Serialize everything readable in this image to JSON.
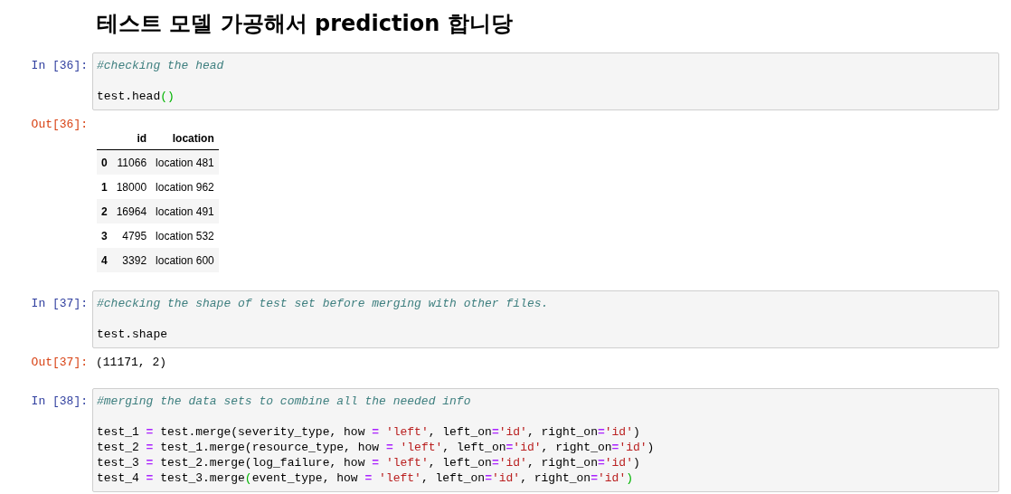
{
  "heading": "테스트 모델 가공해서 prediction 합니당",
  "cells": [
    {
      "kind": "input",
      "prompt": "In [36]:",
      "comment": "#checking the head",
      "lines": [
        [
          {
            "kind": "name",
            "text": "test.head"
          },
          {
            "kind": "match",
            "text": "()"
          }
        ]
      ]
    },
    {
      "kind": "table",
      "prompt": "Out[36]:",
      "columns": [
        "id",
        "location"
      ],
      "rows": [
        {
          "index": "0",
          "cells": [
            "11066",
            "location 481"
          ]
        },
        {
          "index": "1",
          "cells": [
            "18000",
            "location 962"
          ]
        },
        {
          "index": "2",
          "cells": [
            "16964",
            "location 491"
          ]
        },
        {
          "index": "3",
          "cells": [
            "4795",
            "location 532"
          ]
        },
        {
          "index": "4",
          "cells": [
            "3392",
            "location 600"
          ]
        }
      ]
    },
    {
      "kind": "input",
      "prompt": "In [37]:",
      "comment": "#checking the shape of test set before merging with other files.",
      "lines": [
        [
          {
            "kind": "name",
            "text": "test.shape"
          }
        ]
      ]
    },
    {
      "kind": "text",
      "prompt": "Out[37]:",
      "text": "(11171, 2)"
    },
    {
      "kind": "input",
      "prompt": "In [38]:",
      "comment": "#merging the data sets to combine all the needed info",
      "lines": [
        [
          {
            "kind": "name",
            "text": "test_1 "
          },
          {
            "kind": "op",
            "text": "="
          },
          {
            "kind": "name",
            "text": " test.merge(severity_type, how "
          },
          {
            "kind": "op",
            "text": "= "
          },
          {
            "kind": "string",
            "text": "'left'"
          },
          {
            "kind": "name",
            "text": ", left_on"
          },
          {
            "kind": "op",
            "text": "="
          },
          {
            "kind": "string",
            "text": "'id'"
          },
          {
            "kind": "name",
            "text": ", right_on"
          },
          {
            "kind": "op",
            "text": "="
          },
          {
            "kind": "string",
            "text": "'id'"
          },
          {
            "kind": "name",
            "text": ")"
          }
        ],
        [
          {
            "kind": "name",
            "text": "test_2 "
          },
          {
            "kind": "op",
            "text": "="
          },
          {
            "kind": "name",
            "text": " test_1.merge(resource_type, how "
          },
          {
            "kind": "op",
            "text": "= "
          },
          {
            "kind": "string",
            "text": "'left'"
          },
          {
            "kind": "name",
            "text": ", left_on"
          },
          {
            "kind": "op",
            "text": "="
          },
          {
            "kind": "string",
            "text": "'id'"
          },
          {
            "kind": "name",
            "text": ", right_on"
          },
          {
            "kind": "op",
            "text": "="
          },
          {
            "kind": "string",
            "text": "'id'"
          },
          {
            "kind": "name",
            "text": ")"
          }
        ],
        [
          {
            "kind": "name",
            "text": "test_3 "
          },
          {
            "kind": "op",
            "text": "="
          },
          {
            "kind": "name",
            "text": " test_2.merge(log_failure, how "
          },
          {
            "kind": "op",
            "text": "= "
          },
          {
            "kind": "string",
            "text": "'left'"
          },
          {
            "kind": "name",
            "text": ", left_on"
          },
          {
            "kind": "op",
            "text": "="
          },
          {
            "kind": "string",
            "text": "'id'"
          },
          {
            "kind": "name",
            "text": ", right_on"
          },
          {
            "kind": "op",
            "text": "="
          },
          {
            "kind": "string",
            "text": "'id'"
          },
          {
            "kind": "name",
            "text": ")"
          }
        ],
        [
          {
            "kind": "name",
            "text": "test_4 "
          },
          {
            "kind": "op",
            "text": "="
          },
          {
            "kind": "name",
            "text": " test_3.merge"
          },
          {
            "kind": "match",
            "text": "("
          },
          {
            "kind": "name",
            "text": "event_type, how "
          },
          {
            "kind": "op",
            "text": "= "
          },
          {
            "kind": "string",
            "text": "'left'"
          },
          {
            "kind": "name",
            "text": ", left_on"
          },
          {
            "kind": "op",
            "text": "="
          },
          {
            "kind": "string",
            "text": "'id'"
          },
          {
            "kind": "name",
            "text": ", right_on"
          },
          {
            "kind": "op",
            "text": "="
          },
          {
            "kind": "string",
            "text": "'id'"
          },
          {
            "kind": "match",
            "text": ")"
          }
        ]
      ]
    }
  ]
}
